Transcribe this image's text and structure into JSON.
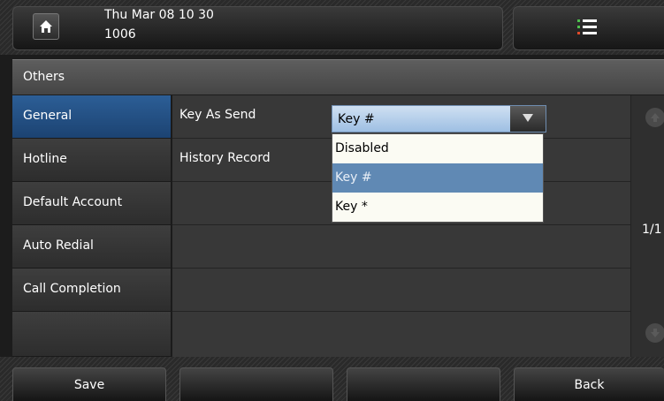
{
  "status_bar": {
    "datetime": "Thu Mar 08 10 30",
    "extension": "1006",
    "home_icon": "home-icon",
    "menu_icon": "menu-list-icon"
  },
  "section": {
    "title": "Others"
  },
  "sidebar": {
    "items": [
      {
        "label": "General",
        "active": true
      },
      {
        "label": "Hotline"
      },
      {
        "label": "Default Account"
      },
      {
        "label": "Auto Redial"
      },
      {
        "label": "Call Completion"
      },
      {
        "label": ""
      }
    ]
  },
  "settings": {
    "rows": [
      {
        "label": "Key As Send"
      },
      {
        "label": "History Record"
      },
      {
        "label": ""
      },
      {
        "label": ""
      },
      {
        "label": ""
      },
      {
        "label": ""
      }
    ],
    "key_as_send": {
      "value": "Key #",
      "options": [
        "Disabled",
        "Key #",
        "Key *"
      ],
      "selected_option": "Key #"
    }
  },
  "pager": {
    "indicator": "1/1"
  },
  "softkeys": {
    "save": "Save",
    "key2": "",
    "key3": "",
    "back": "Back"
  },
  "colors": {
    "active_blue": "#1f4a7d",
    "selected_option": "#6089b4"
  }
}
